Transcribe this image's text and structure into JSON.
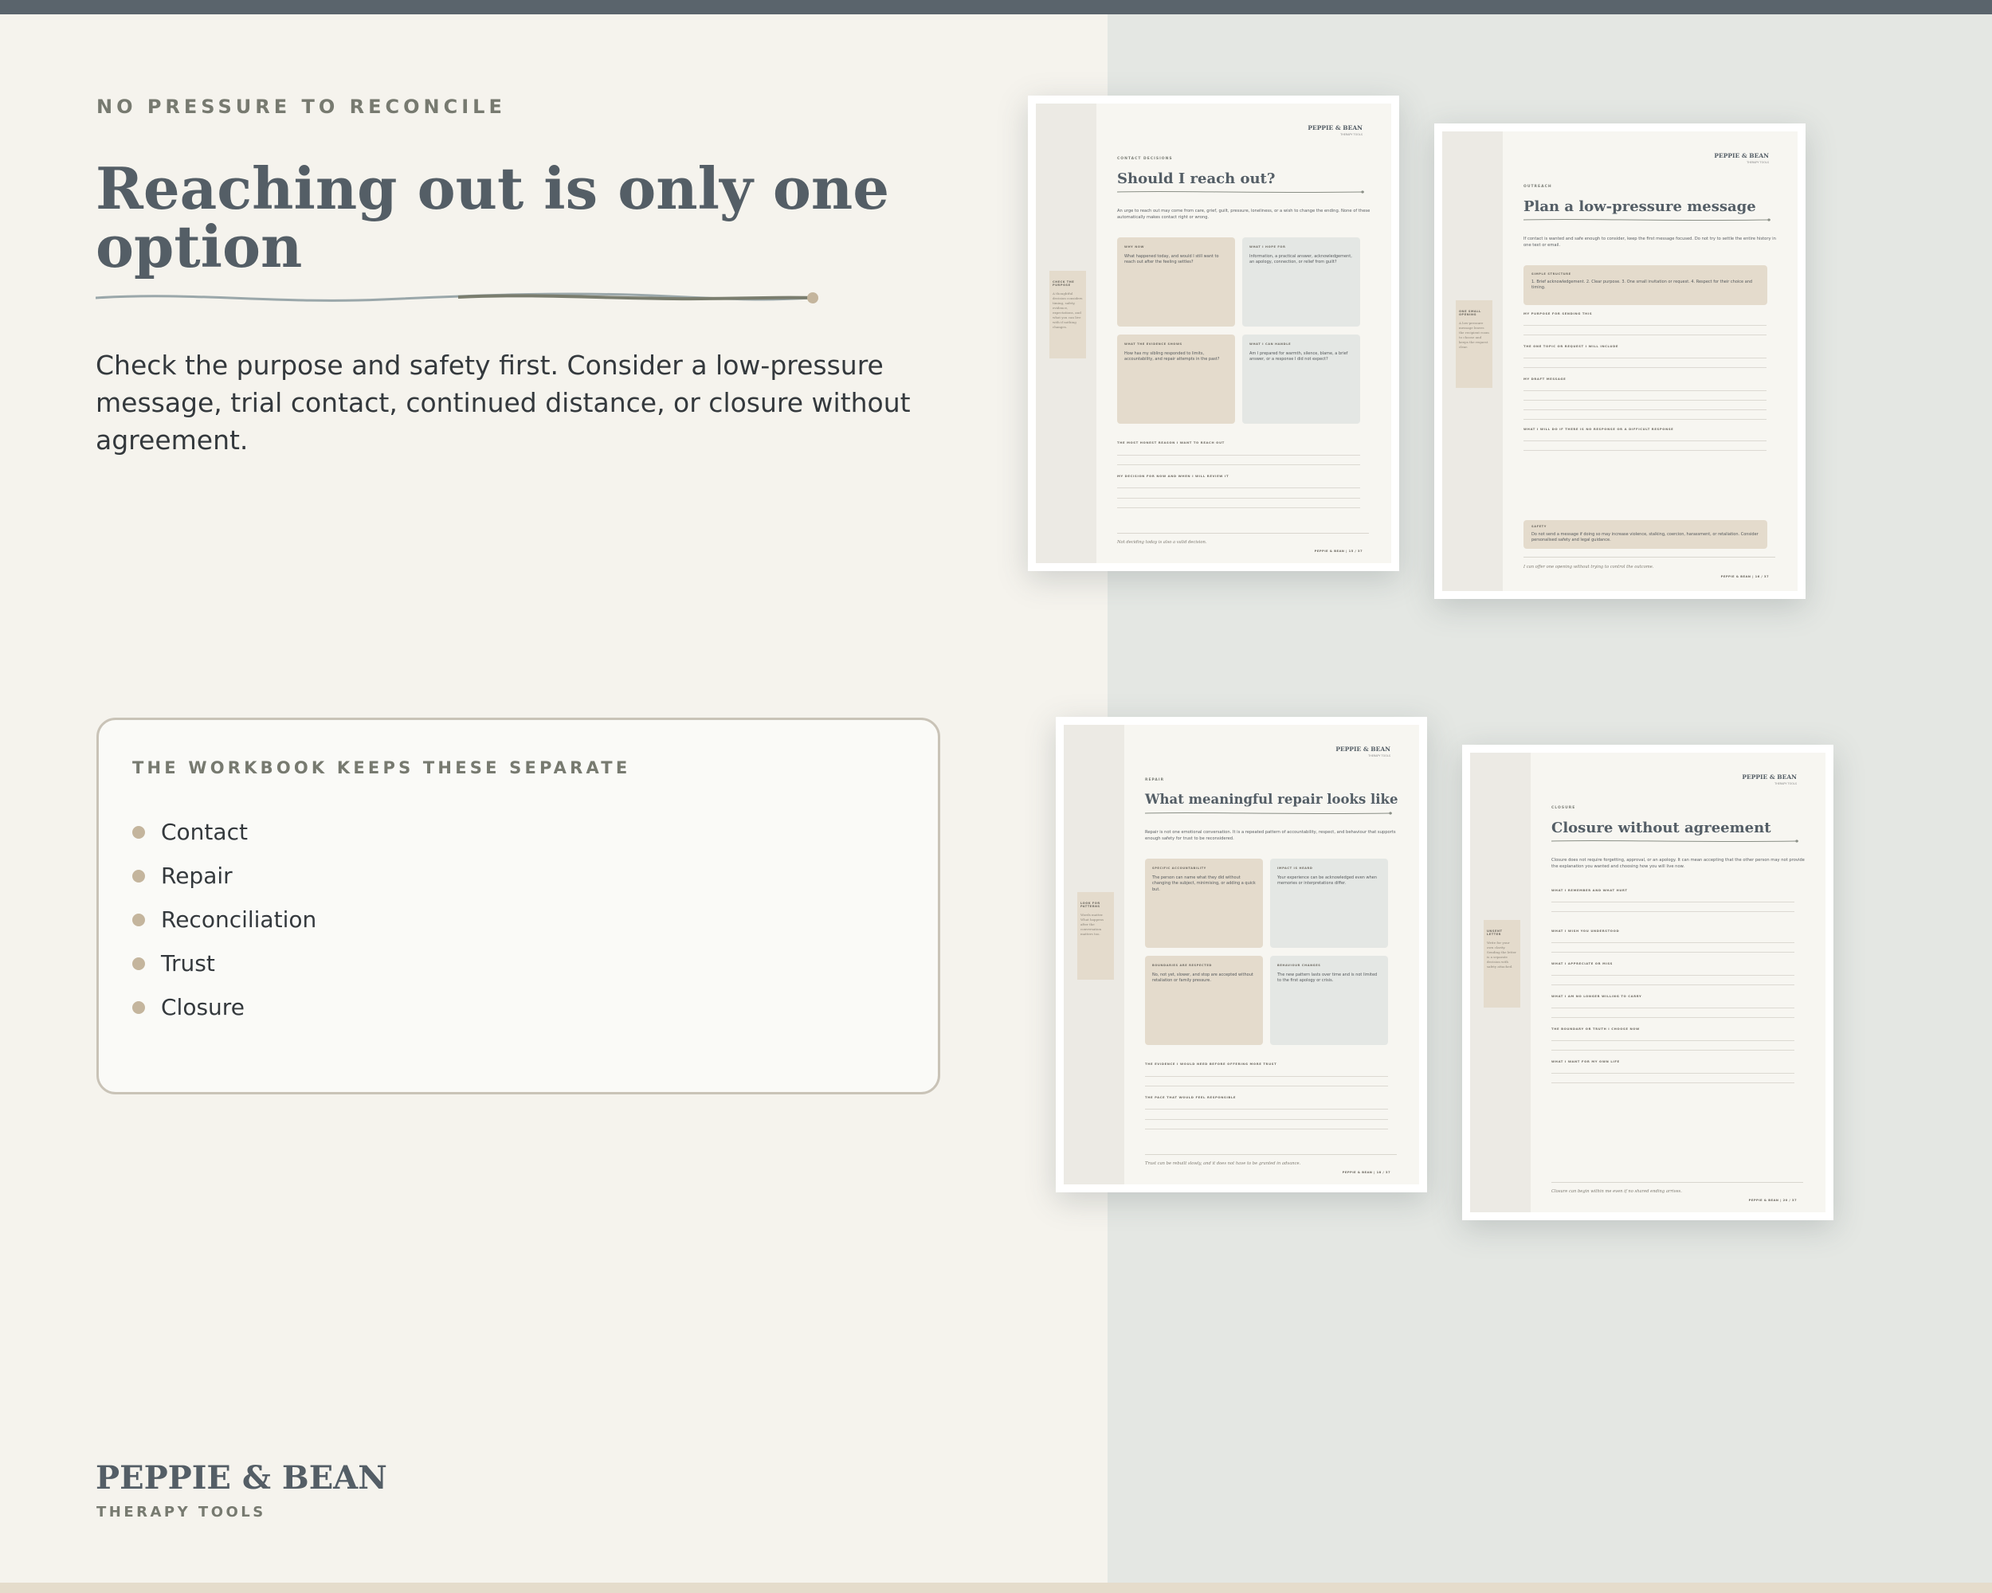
{
  "hero": {
    "eyebrow": "NO PRESSURE TO RECONCILE",
    "headline": "Reaching out is only one option",
    "intro": "Check the purpose and safety first. Consider a low-pressure message, trial contact, continued distance, or closure without agreement."
  },
  "separate": {
    "title": "THE WORKBOOK KEEPS THESE SEPARATE",
    "items": [
      "Contact",
      "Repair",
      "Reconciliation",
      "Trust",
      "Closure"
    ]
  },
  "brand": {
    "name": "PEPPIE & BEAN",
    "tagline": "THERAPY TOOLS"
  },
  "colors": {
    "accent": "#545e66",
    "tan": "#e4dbcc",
    "sage": "#e4e7e3",
    "bullet": "#c4b59d"
  },
  "sheets": [
    {
      "brand": "PEPPIE & BEAN",
      "brand_sub": "THERAPY TOOLS",
      "eyebrow": "CONTACT DECISIONS",
      "title": "Should I reach out?",
      "intro": "An urge to reach out may come from care, grief, guilt, pressure, loneliness, or a wish to change the ending. None of these automatically makes contact right or wrong.",
      "side_title": "CHECK THE PURPOSE",
      "side_body": "A thoughtful decision considers timing, safety, evidence, expectations, and what you can live with if nothing changes.",
      "boxes": [
        {
          "title": "WHY NOW",
          "body": "What happened today, and would I still want to reach out after the feeling settles?"
        },
        {
          "title": "WHAT I HOPE FOR",
          "body": "Information, a practical answer, acknowledgement, an apology, connection, or relief from guilt?"
        },
        {
          "title": "WHAT THE EVIDENCE SHOWS",
          "body": "How has my sibling responded to limits, accountability, and repair attempts in the past?"
        },
        {
          "title": "WHAT I CAN HANDLE",
          "body": "Am I prepared for warmth, silence, blame, a brief answer, or a response I did not expect?"
        }
      ],
      "prompts": [
        "THE MOST HONEST REASON I WANT TO REACH OUT",
        "MY DECISION FOR NOW AND WHEN I WILL REVIEW IT"
      ],
      "footer": "Not deciding today is also a valid decision.",
      "page": "PEPPIE & BEAN | 15 / 37"
    },
    {
      "brand": "PEPPIE & BEAN",
      "brand_sub": "THERAPY TOOLS",
      "eyebrow": "OUTREACH",
      "title": "Plan a low-pressure message",
      "intro": "If contact is wanted and safe enough to consider, keep the first message focused. Do not try to settle the entire history in one text or email.",
      "side_title": "ONE SMALL OPENING",
      "side_body": "A low-pressure message leaves the recipient room to choose and keeps the request clear.",
      "structure_title": "SIMPLE STRUCTURE",
      "structure_body": "1. Brief acknowledgement. 2. Clear purpose. 3. One small invitation or request. 4. Respect for their choice and timing.",
      "prompts": [
        "MY PURPOSE FOR SENDING THIS",
        "THE ONE TOPIC OR REQUEST I WILL INCLUDE",
        "MY DRAFT MESSAGE",
        "WHAT I WILL DO IF THERE IS NO RESPONSE OR A DIFFICULT RESPONSE"
      ],
      "safety_title": "SAFETY",
      "safety_body": "Do not send a message if doing so may increase violence, stalking, coercion, harassment, or retaliation. Consider personalised safety and legal guidance.",
      "footer": "I can offer one opening without trying to control the outcome.",
      "page": "PEPPIE & BEAN | 16 / 37"
    },
    {
      "brand": "PEPPIE & BEAN",
      "brand_sub": "THERAPY TOOLS",
      "eyebrow": "REPAIR",
      "title": "What meaningful repair looks like",
      "intro": "Repair is not one emotional conversation. It is a repeated pattern of accountability, respect, and behaviour that supports enough safety for trust to be reconsidered.",
      "side_title": "LOOK FOR PATTERNS",
      "side_body": "Words matter. What happens after the conversation matters too.",
      "boxes": [
        {
          "title": "SPECIFIC ACCOUNTABILITY",
          "body": "The person can name what they did without changing the subject, minimising, or adding a quick but."
        },
        {
          "title": "IMPACT IS HEARD",
          "body": "Your experience can be acknowledged even when memories or interpretations differ."
        },
        {
          "title": "BOUNDARIES ARE RESPECTED",
          "body": "No, not yet, slower, and stop are accepted without retaliation or family pressure."
        },
        {
          "title": "BEHAVIOUR CHANGES",
          "body": "The new pattern lasts over time and is not limited to the first apology or crisis."
        }
      ],
      "prompts": [
        "THE EVIDENCE I WOULD NEED BEFORE OFFERING MORE TRUST",
        "THE PACE THAT WOULD FEEL RESPONSIBLE"
      ],
      "footer": "Trust can be rebuilt slowly, and it does not have to be granted in advance.",
      "page": "PEPPIE & BEAN | 18 / 37"
    },
    {
      "brand": "PEPPIE & BEAN",
      "brand_sub": "THERAPY TOOLS",
      "eyebrow": "CLOSURE",
      "title": "Closure without agreement",
      "intro": "Closure does not require forgetting, approval, or an apology. It can mean accepting that the other person may not provide the explanation you wanted and choosing how you will live now.",
      "side_title": "UNSENT LETTER",
      "side_body": "Write for your own clarity. Sending the letter is a separate decision with safety attached.",
      "prompts": [
        "WHAT I REMEMBER AND WHAT HURT",
        "WHAT I WISH YOU UNDERSTOOD",
        "WHAT I APPRECIATE OR MISS",
        "WHAT I AM NO LONGER WILLING TO CARRY",
        "THE BOUNDARY OR TRUTH I CHOOSE NOW",
        "WHAT I WANT FOR MY OWN LIFE"
      ],
      "footer": "Closure can begin within me even if no shared ending arrives.",
      "page": "PEPPIE & BEAN | 20 / 37"
    }
  ]
}
